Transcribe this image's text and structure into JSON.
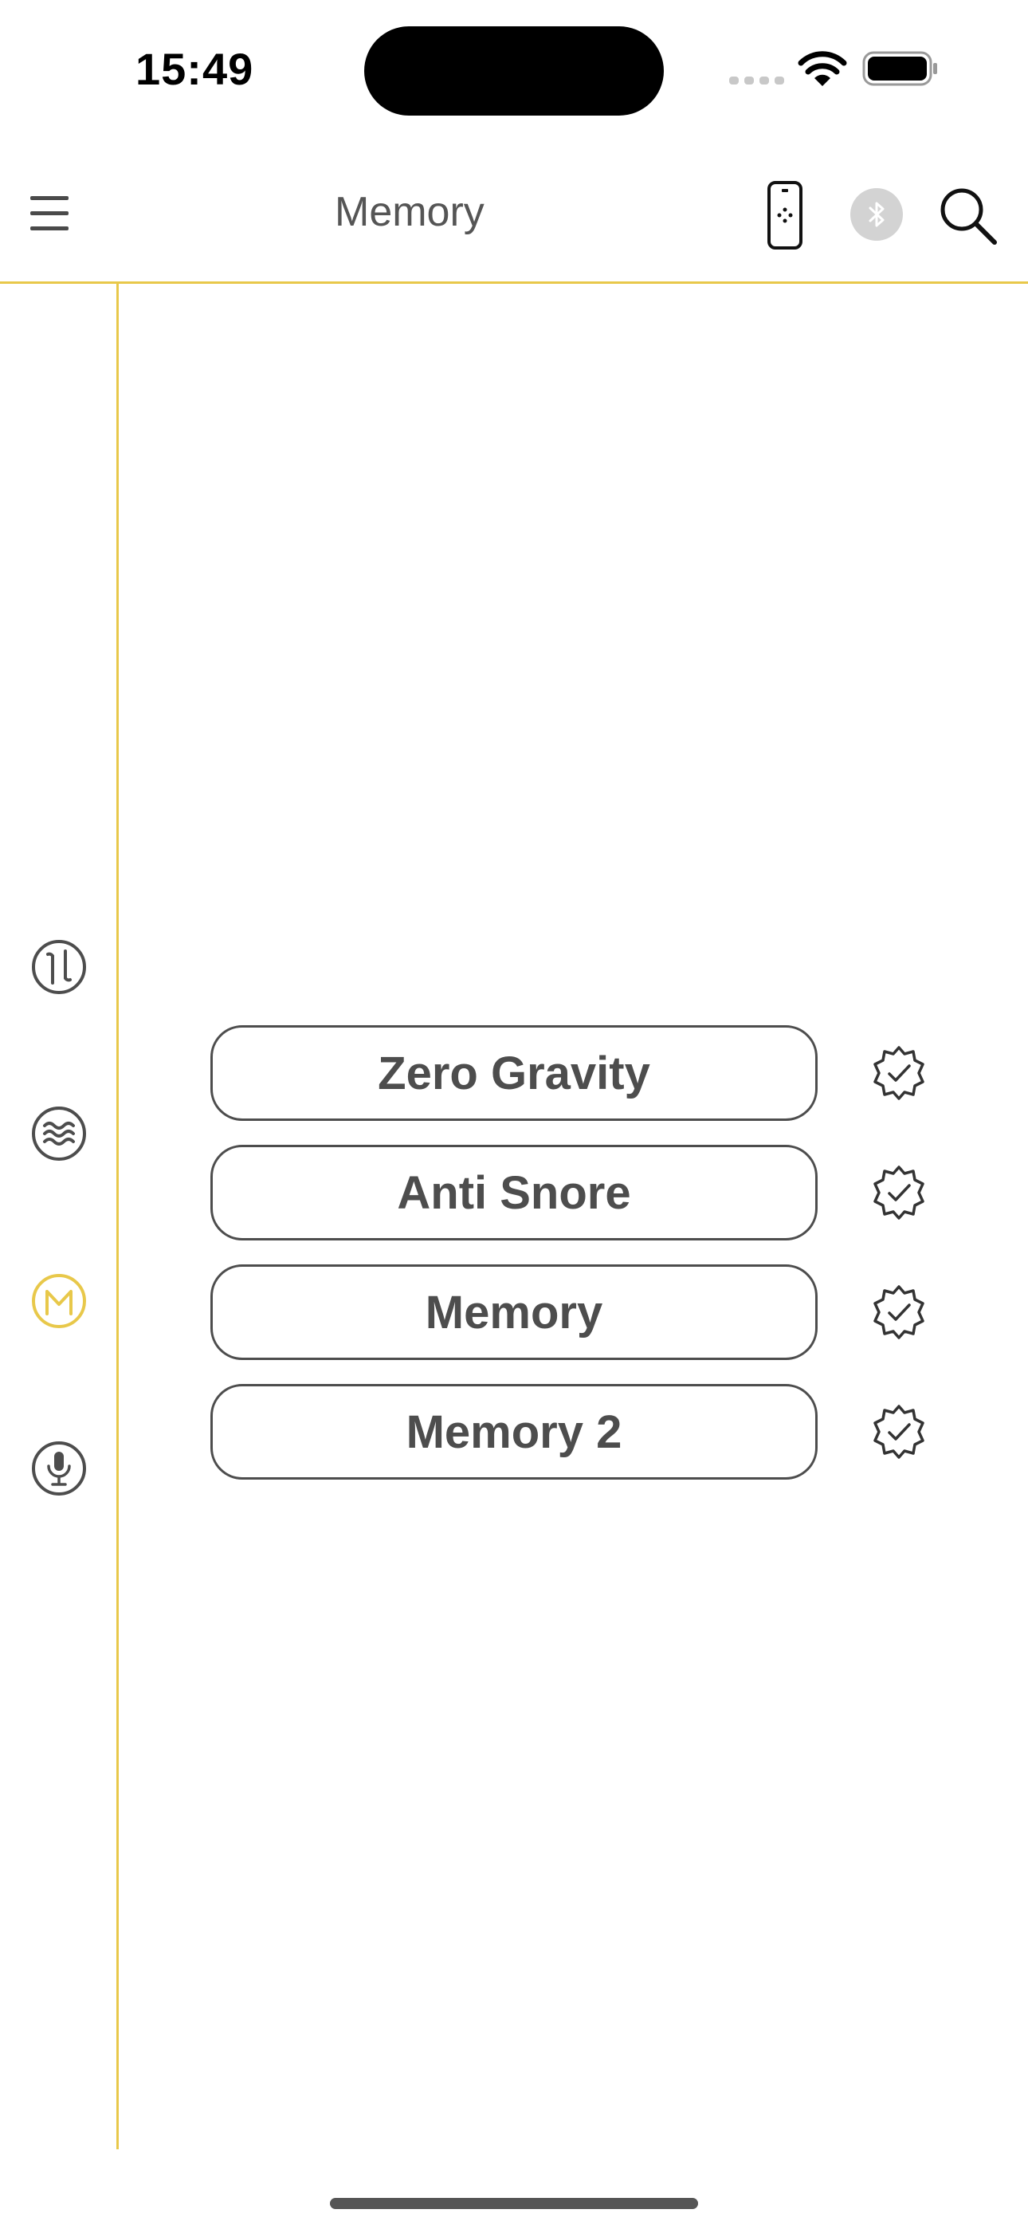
{
  "status_bar": {
    "time": "15:49",
    "icons": [
      "signal-dots-icon",
      "wifi-icon",
      "battery-icon"
    ]
  },
  "header": {
    "title": "Memory",
    "icons": [
      "hamburger-menu-icon",
      "remote-control-icon",
      "bluetooth-icon",
      "search-icon"
    ]
  },
  "sidebar": {
    "items": [
      {
        "icon": "flat-incline-icon",
        "active": false
      },
      {
        "icon": "massage-wave-icon",
        "active": false
      },
      {
        "icon": "memory-m-icon",
        "active": true
      },
      {
        "icon": "microphone-icon",
        "active": false
      }
    ]
  },
  "memory_positions": [
    {
      "label": "Zero Gravity",
      "action_icon": "save-verified-icon"
    },
    {
      "label": "Anti Snore",
      "action_icon": "save-verified-icon"
    },
    {
      "label": "Memory",
      "action_icon": "save-verified-icon"
    },
    {
      "label": "Memory 2",
      "action_icon": "save-verified-icon"
    }
  ],
  "colors": {
    "accent": "#e8c84a",
    "text": "#4d4d4d",
    "bluetooth_bg": "#d3d3d3"
  }
}
